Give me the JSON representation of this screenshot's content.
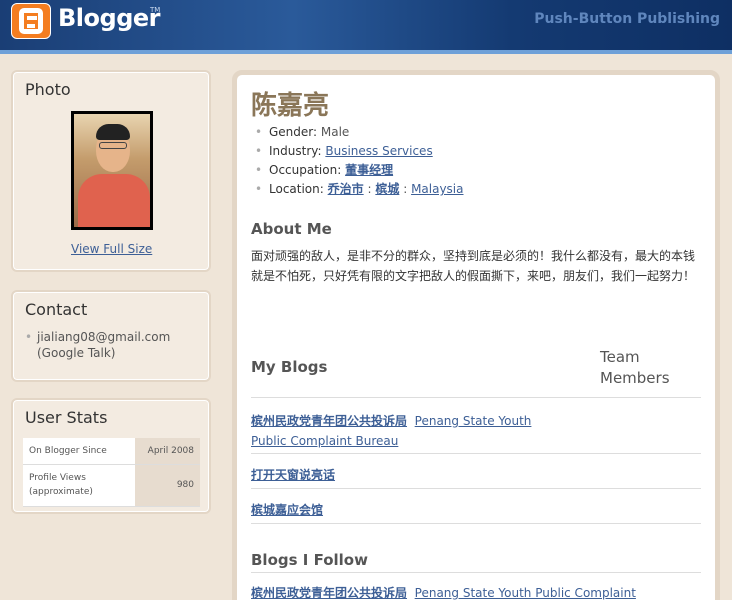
{
  "header": {
    "brand": "Blogger",
    "brand_tm": "TM",
    "tagline": "Push-Button Publishing"
  },
  "sidebar": {
    "photo": {
      "title": "Photo",
      "view_full_size": "View Full Size"
    },
    "contact": {
      "title": "Contact",
      "email": "jialiang08@gmail.com",
      "note": "(Google Talk)"
    },
    "stats": {
      "title": "User Stats",
      "rows": [
        {
          "label": "On Blogger Since",
          "value": "April 2008"
        },
        {
          "label_line1": "Profile Views",
          "label_line2": "(approximate)",
          "value": "980"
        }
      ]
    }
  },
  "profile": {
    "name": "陈嘉亮",
    "gender_label": "Gender:",
    "gender_value": "Male",
    "industry_label": "Industry:",
    "industry_value": "Business Services",
    "occupation_label": "Occupation:",
    "occupation_value": "董事经理",
    "location_label": "Location:",
    "location_city": "乔治市",
    "location_region": "槟城",
    "location_country": "Malaysia",
    "separator": ":"
  },
  "about": {
    "title": "About Me",
    "text": "面对顽强的敌人，是非不分的群众，坚持到底是必须的！我什么都没有，最大的本钱就是不怕死，只好凭有限的文字把敌人的假面撕下，来吧，朋友们，我们一起努力！"
  },
  "my_blogs": {
    "title": "My Blogs",
    "team_title": "Team Members",
    "items": [
      {
        "zh": "槟州民政党青年团公共投诉局",
        "en_line1": "Penang State Youth",
        "en_line2": "Public Complaint Bureau"
      },
      {
        "zh": "打开天窗说亮话"
      },
      {
        "zh": "槟城嘉应会馆"
      }
    ]
  },
  "blogs_i_follow": {
    "title": "Blogs I Follow",
    "items": [
      {
        "zh": "槟州民政党青年团公共投诉局",
        "en": "Penang State Youth Public Complaint"
      }
    ]
  }
}
